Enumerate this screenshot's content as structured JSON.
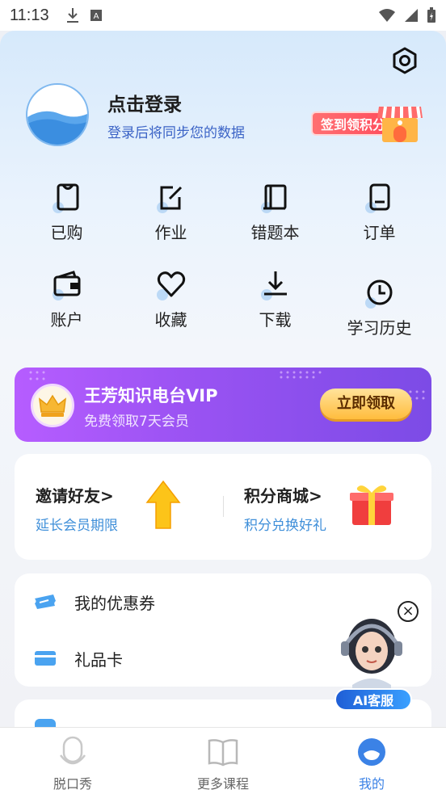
{
  "status_bar": {
    "time": "11:13"
  },
  "profile": {
    "login_title": "点击登录",
    "login_subtitle": "登录后将同步您的数据",
    "checkin_label": "签到领积分"
  },
  "grid": [
    {
      "label": "已购",
      "icon": "bag-icon"
    },
    {
      "label": "作业",
      "icon": "edit-icon"
    },
    {
      "label": "错题本",
      "icon": "notebook-icon"
    },
    {
      "label": "订单",
      "icon": "order-icon"
    },
    {
      "label": "账户",
      "icon": "wallet-icon"
    },
    {
      "label": "收藏",
      "icon": "heart-icon"
    },
    {
      "label": "下载",
      "icon": "download-icon"
    },
    {
      "label": "学习历史",
      "icon": "clock-icon"
    }
  ],
  "vip": {
    "title": "王芳知识电台VIP",
    "subtitle": "免费领取7天会员",
    "button": "立即领取"
  },
  "promo": {
    "invite_title": "邀请好友>",
    "invite_sub": "延长会员期限",
    "shop_title": "积分商城>",
    "shop_sub": "积分兑换好礼"
  },
  "list": {
    "coupon": "我的优惠券",
    "gift_card": "礼品卡"
  },
  "ai": {
    "label": "AI客服"
  },
  "bottom_nav": {
    "tab1": "脱口秀",
    "tab2": "更多课程",
    "tab3": "我的"
  },
  "colors": {
    "accent": "#3b82e6",
    "vip_start": "#b65dff",
    "vip_end": "#7c4be6"
  }
}
